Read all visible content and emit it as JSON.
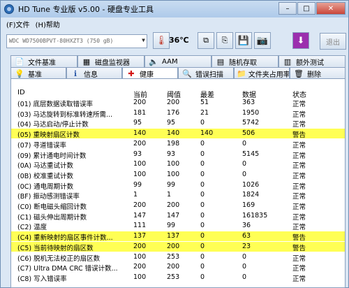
{
  "window": {
    "title": "HD Tune 专业版 v5.00 - 硬盘专业工具",
    "minimize": "–",
    "maximize": "□",
    "close": "✕"
  },
  "menu": {
    "file": "(F)文件",
    "help": "(H)帮助"
  },
  "toolbar": {
    "drive": "WDC WD7500BPVT-80HXZT3 (750 gB)",
    "temperature": "36℃",
    "exit": "退出",
    "icons": [
      "copy-icon",
      "copy-text-icon",
      "save-icon",
      "screenshot-icon",
      "download-icon"
    ]
  },
  "tabs_top": [
    {
      "label": "文件基准",
      "icon": "file-benchmark-icon",
      "glyph": "📄"
    },
    {
      "label": "磁盘监视器",
      "icon": "monitor-icon",
      "glyph": "▦"
    },
    {
      "label": "AAM",
      "icon": "speaker-icon",
      "glyph": "🔈"
    },
    {
      "label": "随机存取",
      "icon": "random-access-icon",
      "glyph": "▤"
    },
    {
      "label": "额外测试",
      "icon": "extra-test-icon",
      "glyph": "▥"
    }
  ],
  "tabs_bottom": [
    {
      "label": "基准",
      "icon": "benchmark-icon",
      "glyph": "💡"
    },
    {
      "label": "信息",
      "icon": "info-icon",
      "glyph": "ℹ"
    },
    {
      "label": "健康",
      "icon": "health-icon",
      "glyph": "✚",
      "active": true
    },
    {
      "label": "错误扫描",
      "icon": "error-scan-icon",
      "glyph": "🔍"
    },
    {
      "label": "文件夹占用率",
      "icon": "folder-icon",
      "glyph": "📁"
    },
    {
      "label": "删除",
      "icon": "delete-icon",
      "glyph": "🗑"
    }
  ],
  "table": {
    "headers": {
      "id": "ID",
      "current": "当前",
      "threshold": "阈值",
      "worst": "最差",
      "data": "数据",
      "status": "状态"
    },
    "dots": "...",
    "rows": [
      {
        "id": "(01) 底层数据读取错误率",
        "cur": "200",
        "thr": "200",
        "worst": "51",
        "data": "363",
        "status": "正常",
        "warn": false
      },
      {
        "id": "(03) 马达旋转到标准转速所需...",
        "cur": "181",
        "thr": "176",
        "worst": "21",
        "data": "1950",
        "status": "正常",
        "warn": false
      },
      {
        "id": "(04) 马达启动/停止计数",
        "cur": "95",
        "thr": "95",
        "worst": "0",
        "data": "5742",
        "status": "正常",
        "warn": false
      },
      {
        "id": "(05) 重映射扇区计数",
        "cur": "140",
        "thr": "140",
        "worst": "140",
        "data": "506",
        "status": "警告",
        "warn": true
      },
      {
        "id": "(07) 寻道错误率",
        "cur": "200",
        "thr": "198",
        "worst": "0",
        "data": "0",
        "status": "正常",
        "warn": false
      },
      {
        "id": "(09) 累计通电时间计数",
        "cur": "93",
        "thr": "93",
        "worst": "0",
        "data": "5145",
        "status": "正常",
        "warn": false
      },
      {
        "id": "(0A) 马达重试计数",
        "cur": "100",
        "thr": "100",
        "worst": "0",
        "data": "0",
        "status": "正常",
        "warn": false
      },
      {
        "id": "(0B) 校准重试计数",
        "cur": "100",
        "thr": "100",
        "worst": "0",
        "data": "0",
        "status": "正常",
        "warn": false
      },
      {
        "id": "(0C) 通电周期计数",
        "cur": "99",
        "thr": "99",
        "worst": "0",
        "data": "1026",
        "status": "正常",
        "warn": false
      },
      {
        "id": "(BF) 振动感测错误率",
        "cur": "1",
        "thr": "1",
        "worst": "0",
        "data": "1824",
        "status": "正常",
        "warn": false
      },
      {
        "id": "(C0) 断电磁头缩回计数",
        "cur": "200",
        "thr": "200",
        "worst": "0",
        "data": "169",
        "status": "正常",
        "warn": false
      },
      {
        "id": "(C1) 磁头伸出周期计数",
        "cur": "147",
        "thr": "147",
        "worst": "0",
        "data": "161835",
        "status": "正常",
        "warn": false
      },
      {
        "id": "(C2) 温度",
        "cur": "111",
        "thr": "99",
        "worst": "0",
        "data": "36",
        "status": "正常",
        "warn": false
      },
      {
        "id": "(C4) 重新映射的扇区事件计数...",
        "cur": "137",
        "thr": "137",
        "worst": "0",
        "data": "63",
        "status": "警告",
        "warn": true
      },
      {
        "id": "(C5) 当前待映射的扇区数",
        "cur": "200",
        "thr": "200",
        "worst": "0",
        "data": "23",
        "status": "警告",
        "warn": true
      },
      {
        "id": "(C6) 脱机无法校正的扇区数",
        "cur": "100",
        "thr": "253",
        "worst": "0",
        "data": "0",
        "status": "正常",
        "warn": false
      },
      {
        "id": "(C7) Ultra DMA CRC 错误计数...",
        "cur": "200",
        "thr": "200",
        "worst": "0",
        "data": "0",
        "status": "正常",
        "warn": false
      },
      {
        "id": "(C8) 写入错误率",
        "cur": "100",
        "thr": "253",
        "worst": "0",
        "data": "0",
        "status": "正常",
        "warn": false
      }
    ]
  }
}
